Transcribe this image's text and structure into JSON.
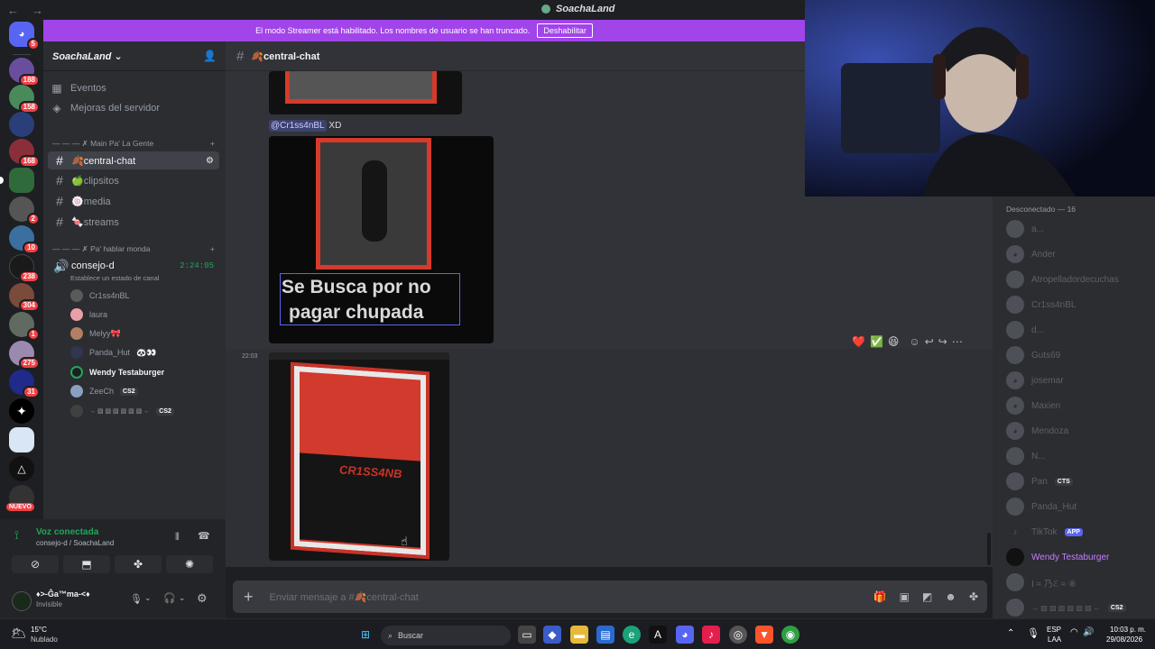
{
  "window": {
    "title": "SoachaLand",
    "back": "←",
    "forward": "→"
  },
  "banner": {
    "text": "El modo Streamer está habilitado. Los nombres de usuario se han truncado.",
    "button": "Deshabilitar"
  },
  "rail": {
    "badges": [
      "5",
      "188",
      "158",
      "168",
      "2",
      "10",
      "238",
      "304",
      "1",
      "275",
      "31"
    ],
    "nuevo": "NUEVO"
  },
  "server": {
    "name": "SoachaLand",
    "items": [
      {
        "label": "Eventos",
        "icon": "calendar-icon"
      },
      {
        "label": "Mejoras del servidor",
        "icon": "boost-icon"
      }
    ],
    "categories": [
      "— — — ✗ Main Pa' La Gente",
      "— — — ✗ Pa' hablar monda"
    ],
    "channels": [
      {
        "label": "🍂central-chat",
        "active": true
      },
      {
        "label": "🍏clipsitos",
        "active": false
      },
      {
        "label": "🍥media",
        "active": false
      },
      {
        "label": "🍬streams",
        "active": false
      }
    ],
    "voice_channel": {
      "label": "consejo-d",
      "timer": "2:24:05",
      "status": "Establece un estado de canal"
    },
    "voice_users": [
      {
        "name": "Cr1ss4nBL",
        "tag": "",
        "color": "#5a5a5a"
      },
      {
        "name": "laura",
        "tag": "",
        "color": "#e8a0a8"
      },
      {
        "name": "Melyy🎀",
        "tag": "",
        "color": "#b08060"
      },
      {
        "name": "Panda_Hut",
        "tag": "🐼👀",
        "color": "#303650"
      },
      {
        "name": "Wendy Testaburger",
        "tag": "",
        "color": "#1e1f22"
      },
      {
        "name": "ZeeCh",
        "tag": "CS2",
        "color": "#8aa0c0"
      },
      {
        "name": "→ ▧ ▧ ▧ ▧ ▧ ▧ ←",
        "tag": "CS2",
        "color": "#404040"
      }
    ]
  },
  "voice_panel": {
    "title": "Voz conectada",
    "sub": "consejo-d / SoachaLand",
    "user": "♦>-Ĝa™ma-<♦",
    "status": "Invisible"
  },
  "channel_header": {
    "name": "🍂central-chat"
  },
  "messages": [
    {
      "mention": "@Cr1ss4nBL",
      "text": "XD",
      "image_caption_line1": "Se Busca por no",
      "image_caption_line2": "pagar chupada"
    },
    {
      "time": "22:03",
      "image_text": "CR1SS4NB"
    }
  ],
  "reactions": [
    "❤️",
    "✅",
    "😆"
  ],
  "input": {
    "placeholder": "Enviar mensaje a #🍂central-chat"
  },
  "members": {
    "header": "Desconectado — 16",
    "list": [
      "a...",
      "Ander",
      "Atropelladordecuchas",
      "Cr1ss4nBL",
      "d...",
      "Guts69",
      "josemar",
      "Maxien",
      "Mendoza",
      "N...",
      "Pan",
      "Panda_Hut",
      "TikTok",
      "Wendy Testaburger",
      "I ≈ 乃ℰ ≈ ⑧",
      "→ ▧ ▧ ▧ ▧ ▧ ▧ ←"
    ],
    "tags": {
      "Pan": "CTS",
      "TikTok": "APP",
      "last": "CS2"
    }
  },
  "taskbar": {
    "weather_temp": "15°C",
    "weather_desc": "Nublado",
    "search": "Buscar",
    "lang": "ESP",
    "lang2": "LAA",
    "time": "10:03 p. m.",
    "date": "29/08/2026"
  },
  "colors": {
    "accent": "#a144ea",
    "online": "#23a55a",
    "red": "#d53a2b"
  }
}
